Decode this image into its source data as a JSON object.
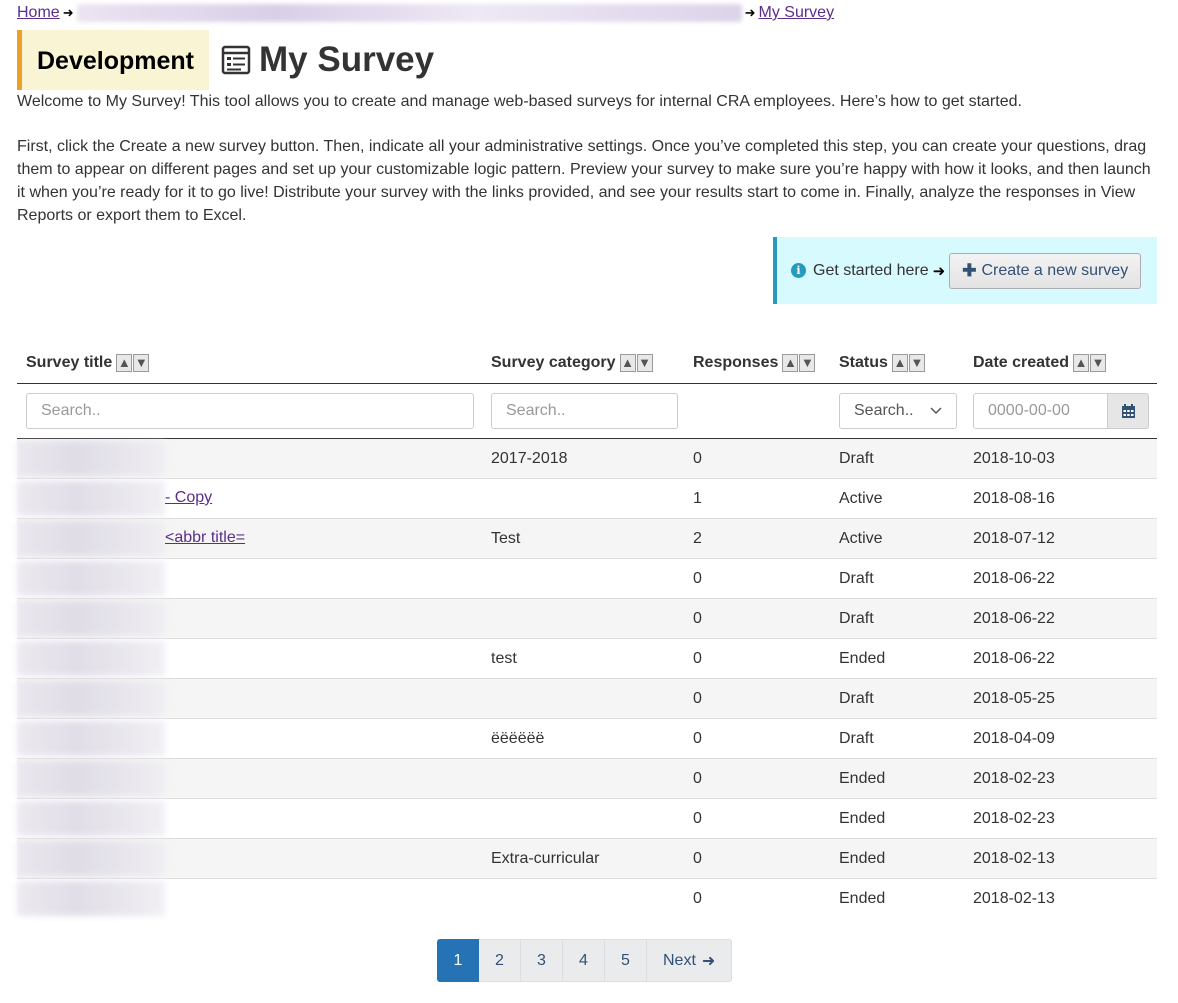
{
  "breadcrumb": {
    "home": "Home",
    "current": "My Survey"
  },
  "header": {
    "badge": "Development",
    "title": "My Survey"
  },
  "intro": {
    "p1": "Welcome to My Survey! This tool allows you to create and manage web-based surveys for internal CRA employees. Here’s how to get started.",
    "p2": "First, click the Create a new survey button. Then, indicate all your administrative settings. Once you’ve completed this step, you can create your questions, drag them to appear on different pages and set up your customizable logic pattern. Preview your survey to make sure you’re happy with how it looks, and then launch it when you’re ready for it to go live! Distribute your survey with the links provided, and see your results start to come in. Finally, analyze the responses in View Reports or export them to Excel."
  },
  "get_started": {
    "text": "Get started here",
    "button": "Create a new survey"
  },
  "table": {
    "columns": [
      "Survey title",
      "Survey category",
      "Responses",
      "Status",
      "Date created"
    ],
    "filters": {
      "title_placeholder": "Search..",
      "category_placeholder": "Search..",
      "status_selected": "Search..",
      "date_placeholder": "0000-00-00"
    },
    "rows": [
      {
        "title_suffix": "",
        "category": "2017-2018",
        "responses": "0",
        "status": "Draft",
        "date": "2018-10-03"
      },
      {
        "title_suffix": "- Copy",
        "category": "",
        "responses": "1",
        "status": "Active",
        "date": "2018-08-16"
      },
      {
        "title_suffix": "<abbr title=",
        "category": "Test",
        "responses": "2",
        "status": "Active",
        "date": "2018-07-12"
      },
      {
        "title_suffix": "",
        "category": "",
        "responses": "0",
        "status": "Draft",
        "date": "2018-06-22"
      },
      {
        "title_suffix": "",
        "category": "",
        "responses": "0",
        "status": "Draft",
        "date": "2018-06-22"
      },
      {
        "title_suffix": "",
        "category": "test",
        "responses": "0",
        "status": "Ended",
        "date": "2018-06-22"
      },
      {
        "title_suffix": "",
        "category": "",
        "responses": "0",
        "status": "Draft",
        "date": "2018-05-25"
      },
      {
        "title_suffix": "",
        "category": "ëëëëëë",
        "responses": "0",
        "status": "Draft",
        "date": "2018-04-09"
      },
      {
        "title_suffix": "",
        "category": "",
        "responses": "0",
        "status": "Ended",
        "date": "2018-02-23"
      },
      {
        "title_suffix": "",
        "category": "",
        "responses": "0",
        "status": "Ended",
        "date": "2018-02-23"
      },
      {
        "title_suffix": "",
        "category": "Extra-curricular",
        "responses": "0",
        "status": "Ended",
        "date": "2018-02-13"
      },
      {
        "title_suffix": "",
        "category": "",
        "responses": "0",
        "status": "Ended",
        "date": "2018-02-13"
      }
    ]
  },
  "pagination": {
    "pages": [
      "1",
      "2",
      "3",
      "4",
      "5"
    ],
    "active": "1",
    "next": "Next"
  },
  "colors": {
    "accent": "#2572b4",
    "badge_bg": "#f9f4d4",
    "badge_border": "#ee9f27",
    "alert_bg": "#d7faff",
    "alert_border": "#269abc",
    "link": "#5a2e8a"
  },
  "icons": {
    "breadcrumb_sep": "arrow-right-icon",
    "title": "survey-form-icon",
    "info": "info-circle-icon",
    "plus": "plus-icon",
    "sort": "sort-arrows-icon",
    "select": "chevron-down-icon",
    "calendar": "calendar-icon",
    "next": "arrow-right-icon"
  }
}
